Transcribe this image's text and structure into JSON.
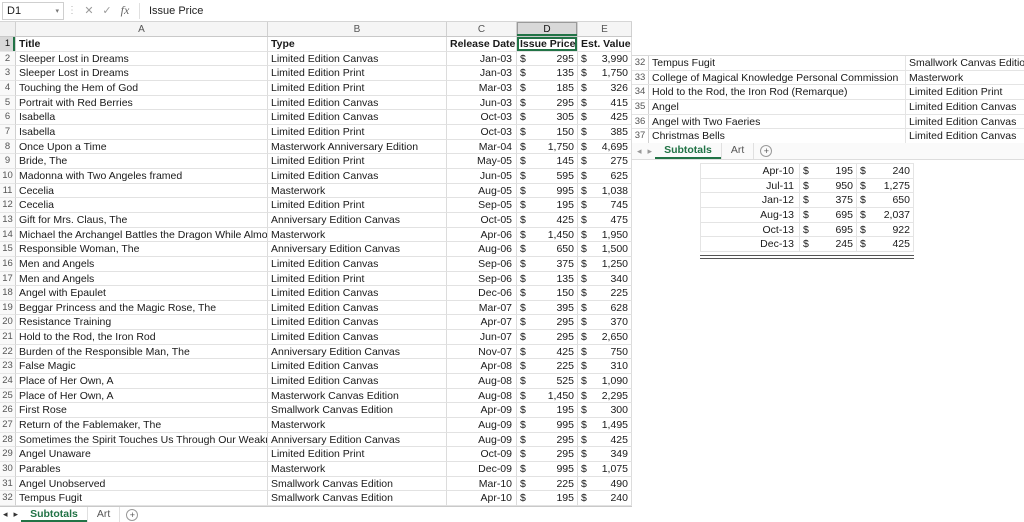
{
  "app": {
    "currency_symbol": "$",
    "accent_color": "#217346",
    "add_sheet_icon": "+",
    "nav_prev_icon": "◂",
    "nav_next_icon": "▸"
  },
  "formula_bar": {
    "cell_ref": "D1",
    "dropdown_icon": "▾",
    "splitter_icon": "⋮",
    "cancel_icon": "✕",
    "accept_icon": "✓",
    "fx_icon": "fx",
    "content": "Issue Price"
  },
  "left_sheet": {
    "column_letters": [
      "A",
      "B",
      "C",
      "D",
      "E"
    ],
    "header_row": {
      "num": "1",
      "title": "Title",
      "type": "Type",
      "release_date": "Release Date",
      "issue_price": "Issue Price",
      "est_value": "Est. Value"
    },
    "rows": [
      {
        "n": "2",
        "title": "Sleeper Lost in Dreams",
        "type": "Limited Edition Canvas",
        "date": "Jan-03",
        "issue": "295",
        "value": "3,990"
      },
      {
        "n": "3",
        "title": "Sleeper Lost in Dreams",
        "type": "Limited Edition Print",
        "date": "Jan-03",
        "issue": "135",
        "value": "1,750"
      },
      {
        "n": "4",
        "title": "Touching the Hem of God",
        "type": "Limited Edition Print",
        "date": "Mar-03",
        "issue": "185",
        "value": "326"
      },
      {
        "n": "5",
        "title": "Portrait with Red Berries",
        "type": "Limited Edition Canvas",
        "date": "Jun-03",
        "issue": "295",
        "value": "415"
      },
      {
        "n": "6",
        "title": "Isabella",
        "type": "Limited Edition Canvas",
        "date": "Oct-03",
        "issue": "305",
        "value": "425"
      },
      {
        "n": "7",
        "title": "Isabella",
        "type": "Limited Edition Print",
        "date": "Oct-03",
        "issue": "150",
        "value": "385"
      },
      {
        "n": "8",
        "title": "Once Upon a Time",
        "type": "Masterwork Anniversary Edition",
        "date": "Mar-04",
        "issue": "1,750",
        "value": "4,695"
      },
      {
        "n": "9",
        "title": "Bride, The",
        "type": "Limited Edition Print",
        "date": "May-05",
        "issue": "145",
        "value": "275"
      },
      {
        "n": "10",
        "title": "Madonna with Two Angeles framed",
        "type": "Limited Edition Canvas",
        "date": "Jun-05",
        "issue": "595",
        "value": "625"
      },
      {
        "n": "11",
        "title": "Cecelia",
        "type": "Masterwork",
        "date": "Aug-05",
        "issue": "995",
        "value": "1,038"
      },
      {
        "n": "12",
        "title": "Cecelia",
        "type": "Limited Edition Print",
        "date": "Sep-05",
        "issue": "195",
        "value": "745"
      },
      {
        "n": "13",
        "title": "Gift for Mrs. Claus, The",
        "type": "Anniversary Edition Canvas",
        "date": "Oct-05",
        "issue": "425",
        "value": "475"
      },
      {
        "n": "14",
        "title": "Michael the Archangel Battles the Dragon While Almost N",
        "type": "Masterwork",
        "date": "Apr-06",
        "issue": "1,450",
        "value": "1,950"
      },
      {
        "n": "15",
        "title": "Responsible Woman, The",
        "type": "Anniversary Edition Canvas",
        "date": "Aug-06",
        "issue": "650",
        "value": "1,500"
      },
      {
        "n": "16",
        "title": "Men and Angels",
        "type": "Limited Edition Canvas",
        "date": "Sep-06",
        "issue": "375",
        "value": "1,250"
      },
      {
        "n": "17",
        "title": "Men and Angels",
        "type": "Limited Edition Print",
        "date": "Sep-06",
        "issue": "135",
        "value": "340"
      },
      {
        "n": "18",
        "title": "Angel with Epaulet",
        "type": "Limited Edition Canvas",
        "date": "Dec-06",
        "issue": "150",
        "value": "225"
      },
      {
        "n": "19",
        "title": "Beggar Princess and the Magic Rose, The",
        "type": "Limited Edition Canvas",
        "date": "Mar-07",
        "issue": "395",
        "value": "628"
      },
      {
        "n": "20",
        "title": "Resistance Training",
        "type": "Limited Edition Canvas",
        "date": "Apr-07",
        "issue": "295",
        "value": "370"
      },
      {
        "n": "21",
        "title": "Hold to the Rod, the Iron Rod",
        "type": "Limited Edition Canvas",
        "date": "Jun-07",
        "issue": "295",
        "value": "2,650"
      },
      {
        "n": "22",
        "title": "Burden of the Responsible Man, The",
        "type": "Anniversary Edition Canvas",
        "date": "Nov-07",
        "issue": "425",
        "value": "750"
      },
      {
        "n": "23",
        "title": "False Magic",
        "type": "Limited Edition Canvas",
        "date": "Apr-08",
        "issue": "225",
        "value": "310"
      },
      {
        "n": "24",
        "title": "Place of Her Own, A",
        "type": "Limited Edition Canvas",
        "date": "Aug-08",
        "issue": "525",
        "value": "1,090"
      },
      {
        "n": "25",
        "title": "Place of Her Own, A",
        "type": "Masterwork Canvas Edition",
        "date": "Aug-08",
        "issue": "1,450",
        "value": "2,295"
      },
      {
        "n": "26",
        "title": "First Rose",
        "type": "Smallwork Canvas Edition",
        "date": "Apr-09",
        "issue": "195",
        "value": "300"
      },
      {
        "n": "27",
        "title": "Return of the Fablemaker, The",
        "type": "Masterwork",
        "date": "Aug-09",
        "issue": "995",
        "value": "1,495"
      },
      {
        "n": "28",
        "title": "Sometimes the Spirit Touches Us Through Our Weaknesses",
        "type": "Anniversary Edition Canvas",
        "date": "Aug-09",
        "issue": "295",
        "value": "425"
      },
      {
        "n": "29",
        "title": "Angel Unaware",
        "type": "Limited Edition Print",
        "date": "Oct-09",
        "issue": "295",
        "value": "349"
      },
      {
        "n": "30",
        "title": "Parables",
        "type": "Masterwork",
        "date": "Dec-09",
        "issue": "995",
        "value": "1,075"
      },
      {
        "n": "31",
        "title": "Angel Unobserved",
        "type": "Smallwork Canvas Edition",
        "date": "Mar-10",
        "issue": "225",
        "value": "490"
      },
      {
        "n": "32",
        "title": "Tempus Fugit",
        "type": "Smallwork Canvas Edition",
        "date": "Apr-10",
        "issue": "195",
        "value": "240"
      }
    ],
    "tabs": [
      {
        "label": "Subtotals",
        "active": true
      },
      {
        "label": "Art",
        "active": false
      }
    ]
  },
  "right_window": {
    "rows": [
      {
        "n": "32",
        "title": "Tempus Fugit",
        "type": "Smallwork Canvas Edition"
      },
      {
        "n": "33",
        "title": "College of Magical Knowledge Personal Commission",
        "type": "Masterwork"
      },
      {
        "n": "34",
        "title": "Hold to the Rod, the Iron Rod (Remarque)",
        "type": "Limited Edition Print"
      },
      {
        "n": "35",
        "title": "Angel",
        "type": "Limited Edition Canvas"
      },
      {
        "n": "36",
        "title": "Angel with Two Faeries",
        "type": "Limited Edition Canvas"
      },
      {
        "n": "37",
        "title": "Christmas Bells",
        "type": "Limited Edition Canvas"
      }
    ],
    "tabs": [
      {
        "label": "Subtotals",
        "active": true
      },
      {
        "label": "Art",
        "active": false
      }
    ],
    "summary_rows": [
      {
        "date": "Apr-10",
        "issue": "195",
        "value": "240"
      },
      {
        "date": "Jul-11",
        "issue": "950",
        "value": "1,275"
      },
      {
        "date": "Jan-12",
        "issue": "375",
        "value": "650"
      },
      {
        "date": "Aug-13",
        "issue": "695",
        "value": "2,037"
      },
      {
        "date": "Oct-13",
        "issue": "695",
        "value": "922"
      },
      {
        "date": "Dec-13",
        "issue": "245",
        "value": "425"
      }
    ]
  }
}
